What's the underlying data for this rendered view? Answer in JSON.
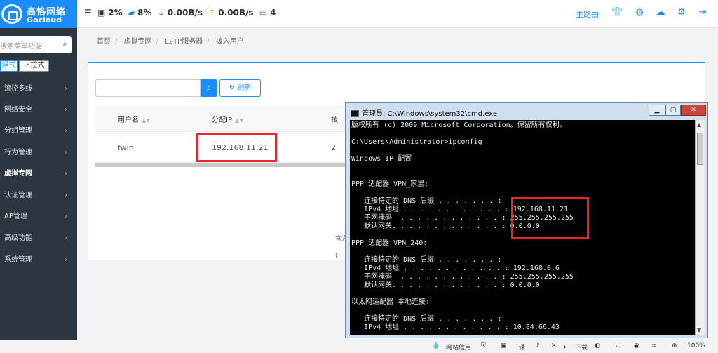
{
  "brand": {
    "name_cn": "高恪网络",
    "name_en": "Gocloud"
  },
  "header": {
    "menu_icon": "menu-toggle-icon",
    "cpu": "2%",
    "mem": "8%",
    "down": "0.00B/s",
    "up": "0.00B/s",
    "devices": "4",
    "main_router": "主路由"
  },
  "sidebar": {
    "search_placeholder": "搜索菜单功能",
    "mode_float": "浮式",
    "mode_dropdown": "下拉式",
    "items": [
      {
        "label": "流控多线"
      },
      {
        "label": "网络安全"
      },
      {
        "label": "分组管理"
      },
      {
        "label": "行为管理"
      },
      {
        "label": "虚拟专网"
      },
      {
        "label": "认证管理"
      },
      {
        "label": "AP管理"
      },
      {
        "label": "高级功能"
      },
      {
        "label": "系统管理"
      }
    ]
  },
  "breadcrumb": [
    "首页",
    "虚拟专网",
    "L2TP服务器",
    "拨入用户"
  ],
  "toolbar": {
    "refresh_label": "刷新"
  },
  "table": {
    "headers": [
      "用户名",
      "分配IP",
      "拨"
    ],
    "rows": [
      [
        "fwin",
        "192.168.11.21",
        "2"
      ]
    ]
  },
  "page_text": {
    "line1": "官方",
    "line2": "("
  },
  "cmd": {
    "title": "管理员: C:\\Windows\\system32\\cmd.exe",
    "lines": [
      "版权所有 (c) 2009 Microsoft Corporation。保留所有权利。",
      "",
      "C:\\Users\\Administrator>ipconfig",
      "",
      "Windows IP 配置",
      "",
      "",
      "PPP 适配器 VPN_家里:",
      "",
      "   连接特定的 DNS 后缀 . . . . . . . :",
      "   IPv4 地址 . . . . . . . . . . . . : 192.168.11.21",
      "   子网掩码  . . . . . . . . . . . . : 255.255.255.255",
      "   默认网关. . . . . . . . . . . . . : 0.0.0.0",
      "",
      "PPP 适配器 VPN_240:",
      "",
      "   连接特定的 DNS 后缀 . . . . . . . :",
      "   IPv4 地址 . . . . . . . . . . . . : 192.168.0.6",
      "   子网掩码  . . . . . . . . . . . . : 255.255.255.255",
      "   默认网关. . . . . . . . . . . . . : 0.0.0.0",
      "",
      "以太网适配器 本地连接:",
      "",
      "   连接特定的 DNS 后缀 . . . . . . . :",
      "   IPv4 地址 . . . . . . . . . . . . : 10.84.66.43"
    ]
  },
  "taskbar": {
    "network": "网站信用",
    "download": "下载",
    "zoom": "100%"
  },
  "colors": {
    "accent": "#1a8cff",
    "sidebar": "#2b3641",
    "highlight": "#e8262b"
  }
}
